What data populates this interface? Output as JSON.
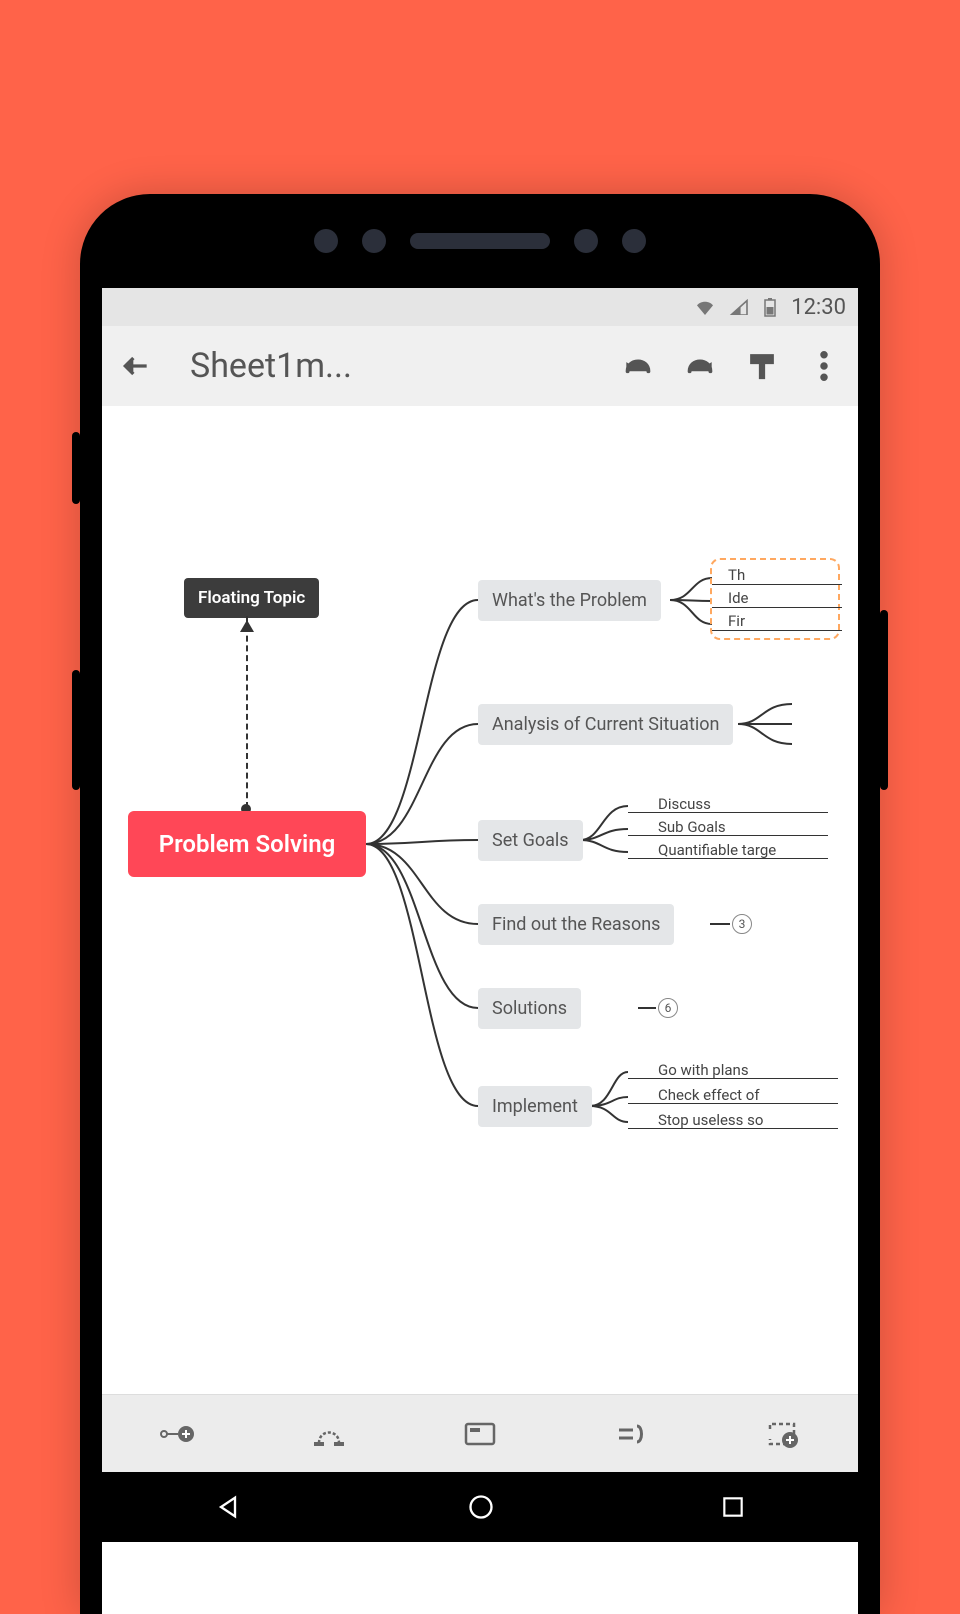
{
  "statusbar": {
    "time": "12:30"
  },
  "toolbar": {
    "title": "Sheet1m..."
  },
  "mindmap": {
    "central": "Problem Solving",
    "floating": "Floating Topic",
    "branches": [
      {
        "label": "What's the Problem",
        "children": [
          "Th",
          "Ide",
          "Fir"
        ]
      },
      {
        "label": "Analysis of Current Situation",
        "children": [
          "",
          "",
          ""
        ]
      },
      {
        "label": "Set Goals",
        "children": [
          "Discuss",
          "Sub Goals",
          "Quantifiable targe"
        ]
      },
      {
        "label": "Find out the Reasons",
        "folded_count": "3"
      },
      {
        "label": "Solutions",
        "folded_count": "6"
      },
      {
        "label": "Implement",
        "children": [
          "Go with plans",
          "Check effect of",
          "Stop useless so"
        ]
      }
    ]
  }
}
